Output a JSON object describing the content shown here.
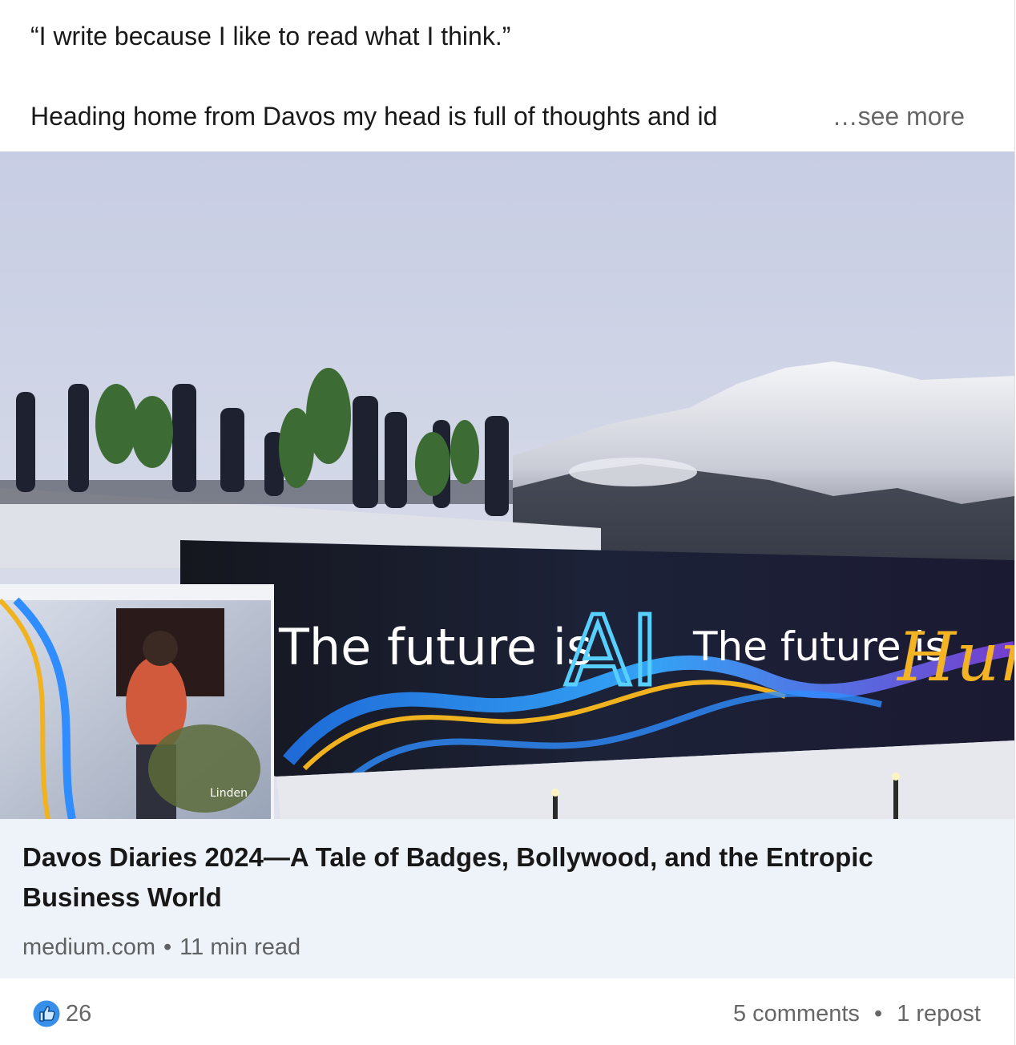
{
  "post": {
    "quote": "“I write because I like to read what I think.”",
    "body_preview": "Heading home from Davos my head is full of thoughts and id",
    "see_more_label": "…see more"
  },
  "article": {
    "image": {
      "banner_text_1": "The future is",
      "banner_ai": "AI",
      "banner_text_2": "The future is",
      "banner_human": "Human",
      "poster_text": "Linden"
    },
    "title": "Davos Diaries 2024—A Tale of Badges, Bollywood, and the Entropic Business World",
    "source": "medium.com",
    "separator": "•",
    "read_time": "11 min read"
  },
  "social": {
    "reaction_icon": "like-icon",
    "reaction_count": "26",
    "comments": "5 comments",
    "separator": "•",
    "reposts": "1 repost"
  },
  "colors": {
    "like_blue": "#378fe9",
    "article_bg": "#edf3f8",
    "muted_text": "#666666"
  }
}
